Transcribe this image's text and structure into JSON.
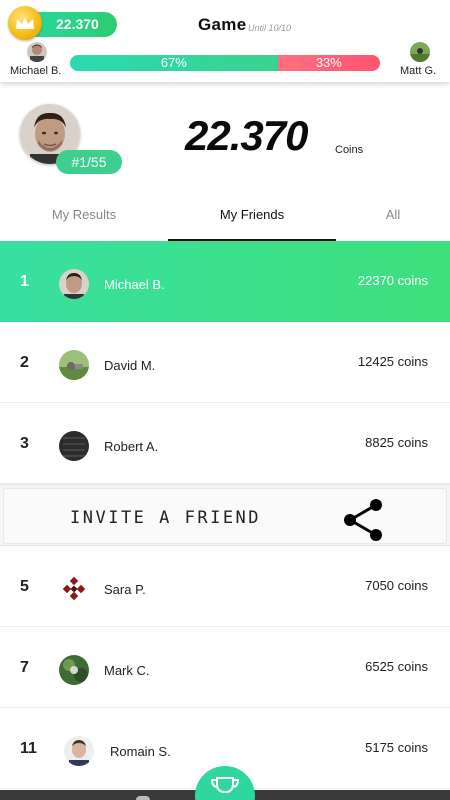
{
  "header": {
    "coin_balance": "22.370",
    "game_title": "Game",
    "game_until": "Until 10/10",
    "left_player": "Michael B.",
    "right_player": "Matt G.",
    "left_percent": "67%",
    "right_percent": "33%",
    "left_share": 0.67,
    "accent": "#2ecc71",
    "versus_right_color": "#ff5a74"
  },
  "profile": {
    "rank": "#1/55",
    "coins": "22.370",
    "coins_unit": "Coins"
  },
  "tabs": [
    {
      "label": "My Results",
      "active": false
    },
    {
      "label": "My Friends",
      "active": true
    },
    {
      "label": "All",
      "active": false
    }
  ],
  "friends": [
    {
      "rank": "1",
      "name": "Michael B.",
      "coins": "22370 coins",
      "highlight": true
    },
    {
      "rank": "2",
      "name": "David M.",
      "coins": "12425 coins"
    },
    {
      "rank": "3",
      "name": "Robert A.",
      "coins": "8825 coins"
    },
    {
      "rank": "5",
      "name": "Sara P.",
      "coins": "7050 coins"
    },
    {
      "rank": "7",
      "name": "Mark C.",
      "coins": "6525 coins"
    },
    {
      "rank": "11",
      "name": "Romain S.",
      "coins": "5175 coins"
    }
  ],
  "invite": {
    "label": "INVITE A FRIEND",
    "icon": "share-icon"
  },
  "bottom": {
    "center_icon": "trophy-icon"
  }
}
